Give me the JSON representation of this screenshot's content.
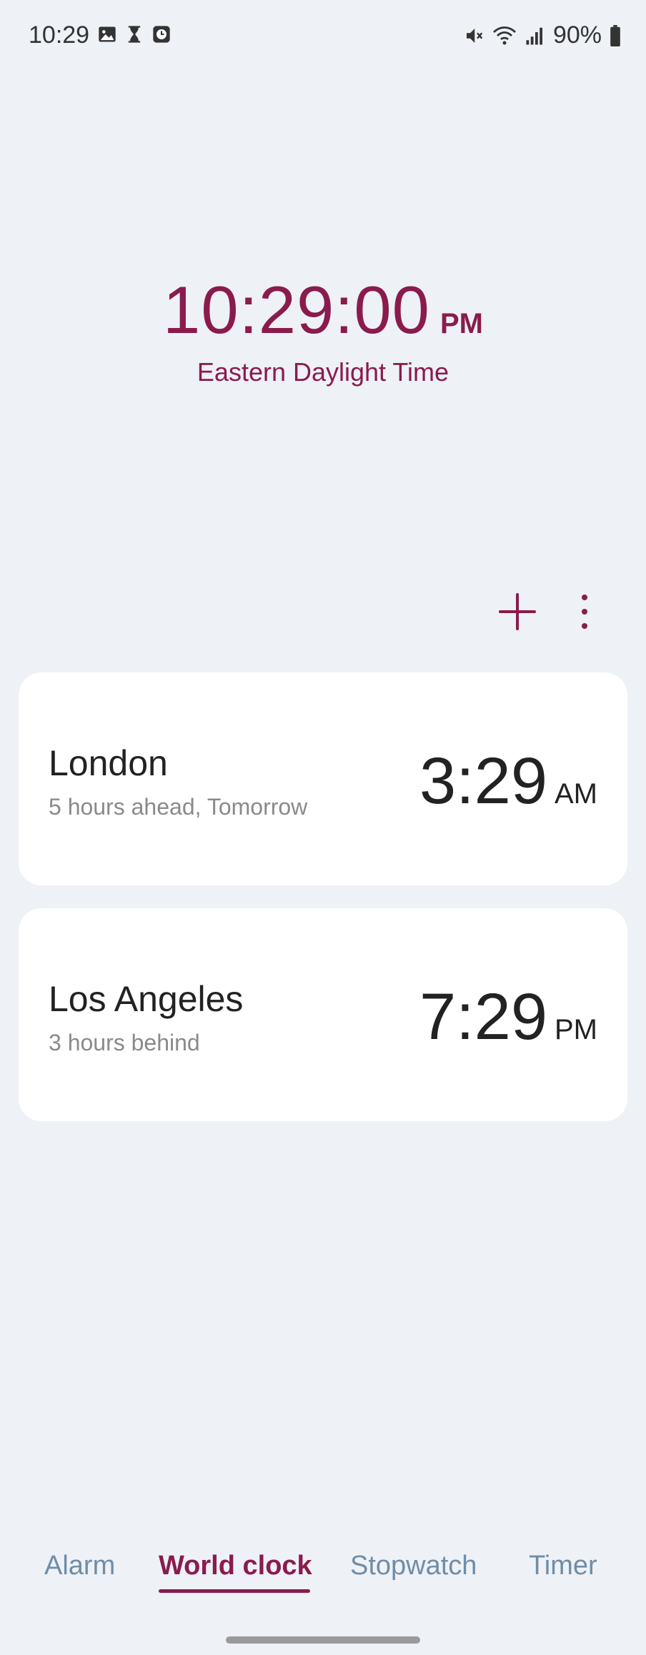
{
  "status_bar": {
    "time": "10:29",
    "battery": "90%",
    "icons": [
      "gallery-icon",
      "hourglass-icon",
      "clock-app-icon",
      "mute-icon",
      "wifi-icon",
      "signal-icon",
      "battery-icon"
    ]
  },
  "main_clock": {
    "time": "10:29:00",
    "ampm": "PM",
    "timezone": "Eastern Daylight Time"
  },
  "toolbar": {
    "icons": [
      "plus-icon",
      "more-vert-icon"
    ]
  },
  "cities": [
    {
      "name": "London",
      "difference": "5 hours ahead, Tomorrow",
      "time": "3:29",
      "ampm": "AM"
    },
    {
      "name": "Los Angeles",
      "difference": "3 hours behind",
      "time": "7:29",
      "ampm": "PM"
    }
  ],
  "tabs": [
    {
      "label": "Alarm",
      "active": false
    },
    {
      "label": "World clock",
      "active": true
    },
    {
      "label": "Stopwatch",
      "active": false
    },
    {
      "label": "Timer",
      "active": false
    }
  ],
  "colors": {
    "accent": "#8a1b4d",
    "background": "#eef1f6",
    "card": "#ffffff",
    "inactive_tab": "#6f8da8",
    "secondary_text": "#8a8a8a"
  }
}
